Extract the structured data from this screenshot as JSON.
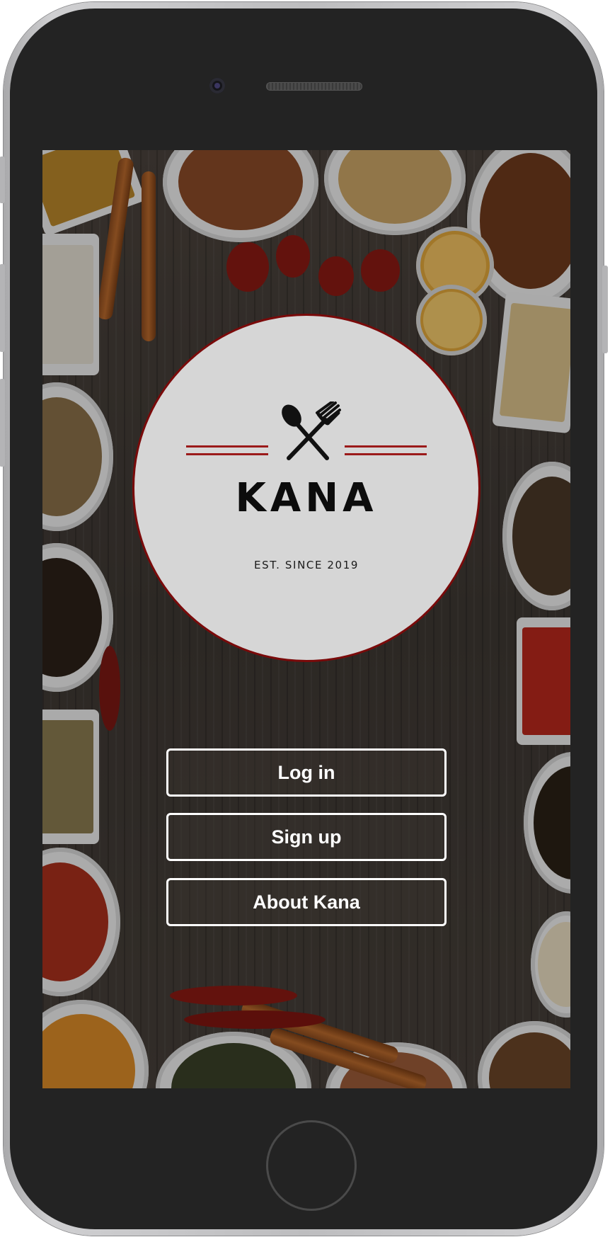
{
  "app": {
    "brand": "KANA",
    "tagline": "EST. SINCE 2019",
    "logo_icon": "spoon-fork-crossed-icon"
  },
  "actions": {
    "login_label": "Log in",
    "signup_label": "Sign up",
    "about_label": "About Kana"
  },
  "colors": {
    "accent": "#9b1a1a",
    "logo_background": "#d6d6d6",
    "button_border": "#ffffff",
    "device_frame": "#232323"
  }
}
